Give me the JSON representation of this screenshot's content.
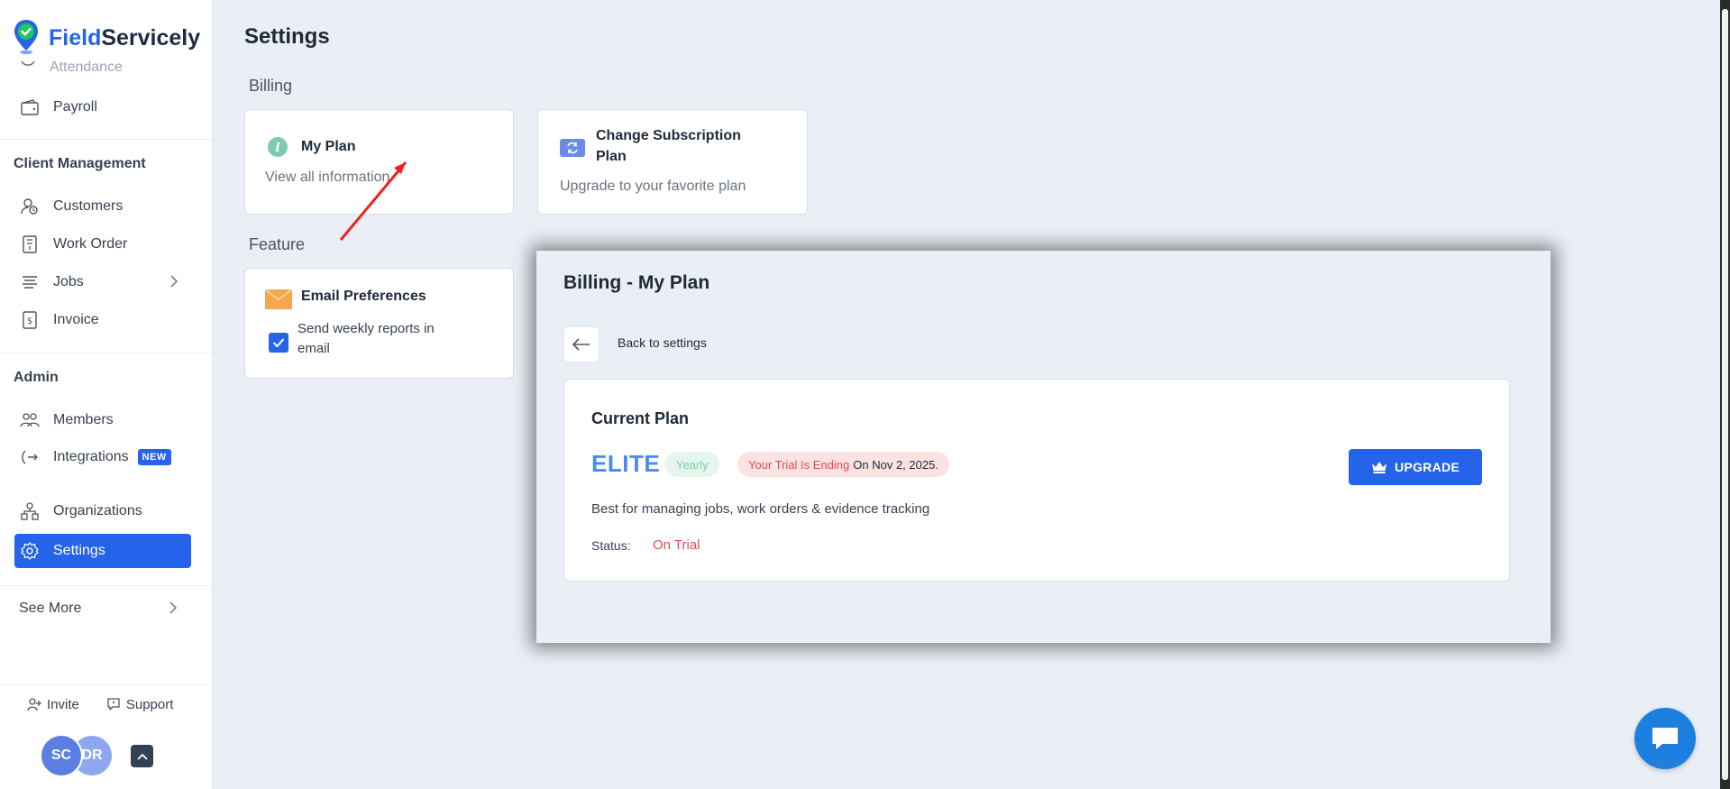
{
  "app": {
    "logo_part1": "Field",
    "logo_part2": "Servicely",
    "brand_color": "#2563eb"
  },
  "sidebar": {
    "truncated_item": "Attendance",
    "payroll": "Payroll",
    "client_section": "Client Management",
    "client_items": [
      {
        "label": "Customers",
        "icon": "customer-icon"
      },
      {
        "label": "Work Order",
        "icon": "work-order-icon"
      },
      {
        "label": "Jobs",
        "icon": "list-icon"
      },
      {
        "label": "Invoice",
        "icon": "invoice-icon"
      }
    ],
    "admin_section": "Admin",
    "admin_items": [
      {
        "label": "Members",
        "icon": "members-icon"
      },
      {
        "label": "Integrations",
        "icon": "integrations-icon",
        "badge": "NEW"
      },
      {
        "label": "Organizations",
        "icon": "organizations-icon"
      },
      {
        "label": "Settings",
        "icon": "gear-icon",
        "active": true
      }
    ],
    "see_more": "See More",
    "invite": "Invite",
    "support": "Support",
    "avatars": [
      {
        "initials": "SC",
        "color": "#5b7fe0"
      },
      {
        "initials": "DR",
        "color": "#8ea7f0"
      }
    ]
  },
  "main": {
    "page_title": "Settings",
    "billing_title": "Billing",
    "feature_title": "Feature",
    "my_plan": {
      "title": "My Plan",
      "description": "View all information"
    },
    "change_plan": {
      "title_line1": "Change Subscription",
      "title_line2": "Plan",
      "description": "Upgrade to your favorite plan"
    },
    "email_prefs": {
      "title": "Email Preferences",
      "checkbox_line1": "Send weekly reports in",
      "checkbox_line2": "email",
      "checked": true
    }
  },
  "overlay": {
    "title": "Billing - My Plan",
    "back_label": "Back to settings",
    "current_plan_title": "Current Plan",
    "plan_name": "ELITE",
    "billing_cycle": "Yearly",
    "trial_label": "Your Trial Is Ending",
    "trial_date": "On Nov 2, 2025.",
    "description": "Best for managing jobs, work orders & evidence tracking",
    "status_label": "Status:",
    "status_value": "On Trial",
    "upgrade_label": "UPGRADE"
  }
}
